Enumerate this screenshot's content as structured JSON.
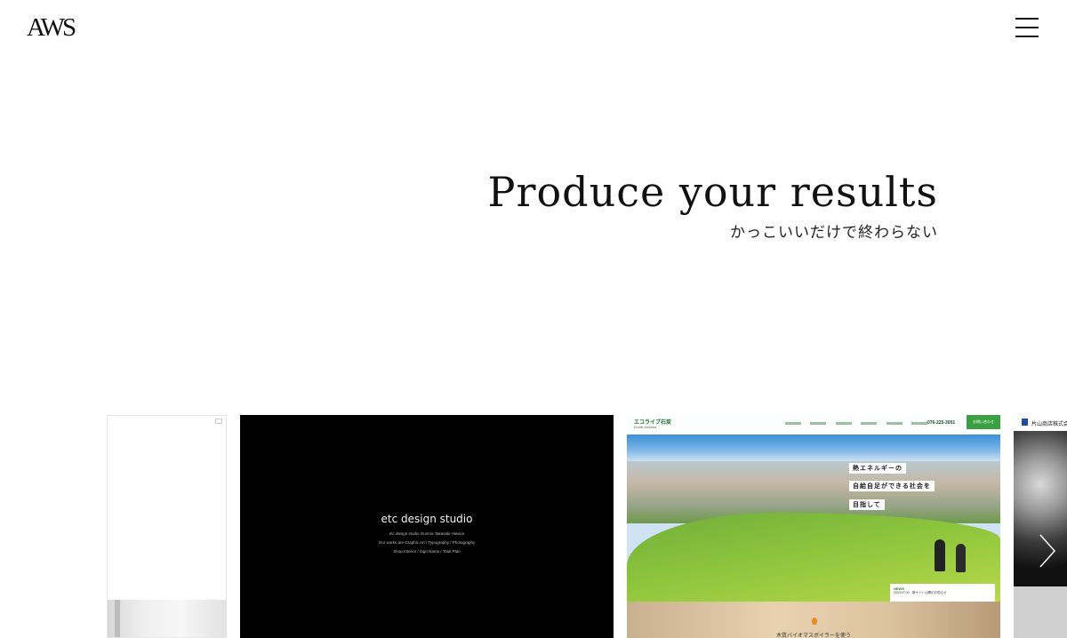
{
  "header": {
    "logo_text": "AWS",
    "menu_icon": "hamburger-menu-icon"
  },
  "hero": {
    "title": "Produce your results",
    "subtitle": "かっこいいだけで終わらない"
  },
  "works": {
    "slide2": {
      "title": "etc design studio",
      "lines": [
        "etc design studio Gunma Takasaki Hiwace",
        "Our works are Graphic Art / Typography / Photography",
        "Shop Interior / Sign Name / Total Plan"
      ]
    },
    "slide3": {
      "brand": "エコライブ石炭",
      "brand_sub": "Ecolife Ishikawa",
      "phone": "076-225-3001",
      "cta": "お問い合わせ",
      "copy_lines": [
        "熱エネルギーの",
        "自給自足ができる社会を",
        "目指して"
      ],
      "news_label": "NEWS",
      "news_text": "2023.07.00　新サイト公開のお知らせ",
      "feature_text": "木質バイオマスボイラーを使う"
    },
    "slide4": {
      "name": "片山商店株式会社"
    },
    "next_icon": "chevron-right-icon"
  }
}
